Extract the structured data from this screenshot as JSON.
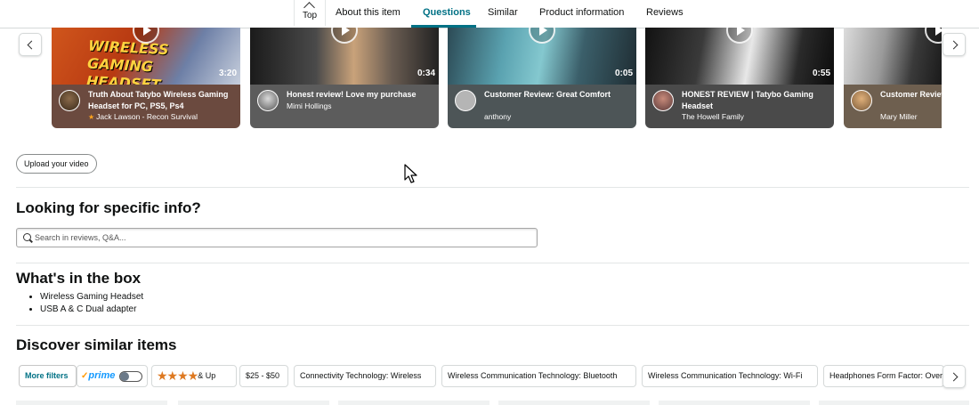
{
  "nav": {
    "top_label": "Top",
    "tabs": [
      "About this item",
      "Questions",
      "Similar",
      "Product information",
      "Reviews"
    ],
    "active_tab": "Questions"
  },
  "videos": [
    {
      "title": "Truth About Tatybo Wireless Gaming Headset for PC, PS5, Ps4",
      "author": "Jack Lawson - Recon Survival",
      "duration": "3:20",
      "thumb_text": "WIRELESS GAMING HEADSET",
      "verified_star": true
    },
    {
      "title": "Honest review! Love my purchase",
      "author": "Mimi Hollings",
      "duration": "0:34"
    },
    {
      "title": "Customer Review: Great Comfort",
      "author": "anthony",
      "duration": "0:05"
    },
    {
      "title": "HONEST REVIEW | Tatybo Gaming Headset",
      "author": "The Howell Family",
      "duration": "0:55"
    },
    {
      "title": "Customer Review: wireless headset",
      "author": "Mary Miller",
      "duration": ""
    }
  ],
  "upload_label": "Upload your video",
  "specific_info": {
    "heading": "Looking for specific info?",
    "search_placeholder": "Search in reviews, Q&A..."
  },
  "box": {
    "heading": "What's in the box",
    "items": [
      "Wireless Gaming Headset",
      "USB A & C Dual adapter"
    ]
  },
  "similar": {
    "heading": "Discover similar items",
    "more_filters": "More filters",
    "prime_label": "prime",
    "rating_label": "& Up",
    "rating_stars": 4,
    "filters": [
      "$25 - $50",
      "Connectivity Technology: Wireless",
      "Wireless Communication Technology: Bluetooth",
      "Wireless Communication Technology: Wi-Fi",
      "Headphones Form Factor: Over Ear"
    ]
  },
  "colors": {
    "accent": "#007185",
    "prime": "#1399ff",
    "star": "#de7921"
  }
}
